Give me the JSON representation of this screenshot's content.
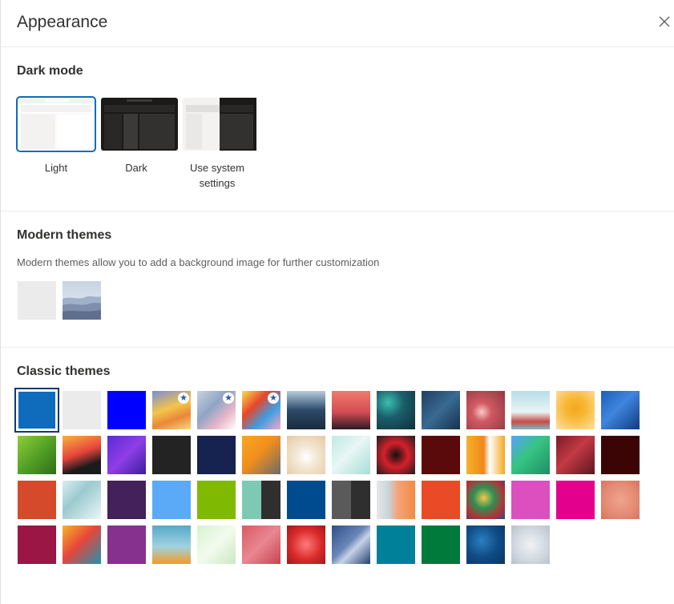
{
  "header": {
    "title": "Appearance",
    "close_icon": "close-icon"
  },
  "dark_mode": {
    "title": "Dark mode",
    "options": [
      {
        "label_lines": [
          "Light"
        ],
        "selected": true
      },
      {
        "label_lines": [
          "Dark"
        ],
        "selected": false
      },
      {
        "label_lines": [
          "Use system",
          "settings"
        ],
        "selected": false
      }
    ]
  },
  "modern_themes": {
    "title": "Modern themes",
    "description": "Modern themes allow you to add a background image for further customization",
    "items": [
      "blank-theme",
      "landscape-theme"
    ]
  },
  "classic_themes": {
    "title": "Classic themes",
    "selected_index": 0,
    "starred_indices": [
      3,
      4,
      5
    ],
    "tiles": [
      "#0f6cbd",
      "#ebebeb",
      "#0000ff",
      "linear-gradient(160deg,#7a8ed6 0%,#f3c548 45%,#e9873a 70%,#f6d77a 100%)",
      "linear-gradient(135deg,#c9d2e0 0%,#8fa4c6 40%,#e7b6c8 70%,#ffffff 100%)",
      "linear-gradient(135deg,#f7e04a 0%,#e8452c 35%,#3f9de0 65%,#f4a7c5 100%)",
      "linear-gradient(180deg,#b7cde0 0%,#2c4a6a 50%,#1a2b3e 100%)",
      "linear-gradient(180deg,#f27a6d 0%,#d44b52 55%,#2a1b24 100%)",
      "radial-gradient(circle at 30% 30%,#3bbfad 0%,#1b5f6b 40%,#0e2f38 100%)",
      "linear-gradient(135deg,#1f3f63 0%,#3a6a92 50%,#15314f 100%)",
      "radial-gradient(circle at 40% 55%,#f6c9c9 0%,#d25a62 30%,#8f3740 100%)",
      "linear-gradient(180deg,#b8dde8 0%,#e8f4f6 55%,#c74b46 80%,#7fb7c7 100%)",
      "radial-gradient(circle at 50% 45%,#f5a623 0%,#f7b733 35%,#ffe0a0 100%)",
      "linear-gradient(135deg,#1e5fb8 0%,#3f85de 45%,#0f3a7e 100%)",
      "linear-gradient(135deg,#8fce3a 0%,#4f9c23 55%,#2f6d1a 100%)",
      "linear-gradient(160deg,#f4b63f 0%,#e8453c 45%,#1b1b1b 75%)",
      "linear-gradient(135deg,#5b2bd6 0%,#8e3ee6 50%,#3d1c9e 100%)",
      "#232323",
      "#16224f",
      "linear-gradient(135deg,#f7a823 0%,#f28e1c 45%,#6b6b6b 100%)",
      "radial-gradient(circle at 50% 55%,#ffffff 0%,#f1e7d2 40%,#e9c7a3 100%)",
      "linear-gradient(135deg,#bfe8e3 0%,#e9f7f5 45%,#a6ddd6 100%)",
      "radial-gradient(circle at 50% 50%,#111111 0%,#d6202b 45%,#1d1d1d 100%)",
      "#5a0a0a",
      "linear-gradient(90deg,#f5b229 0%,#f0861a 45%,#ffffff 60%,#f4a820 100%)",
      "linear-gradient(135deg,#5aa0ff 0%,#36c483 45%,#1f8d63 100%)",
      "linear-gradient(135deg,#7a1c26 0%,#c23a44 45%,#5e1520 100%)",
      "#3b0505",
      "#d44a2a",
      "linear-gradient(135deg,#d8eef2 0%,#9cc9cf 40%,#e8f6f7 100%)",
      "#44215a",
      "#5aaaf7",
      "#7fba00",
      "linear-gradient(90deg,#7ec9b4 0%,#7ec9b4 50%,#2f2f2f 50%,#2f2f2f 100%)",
      "#004b8f",
      "linear-gradient(90deg,#5a5a5a 0%,#5a5a5a 50%,#2f2f2f 50%,#2f2f2f 100%)",
      "linear-gradient(90deg,#e7e7e7 0%,#c9d4dc 30%,#f4a37a 55%,#f28b3f 100%)",
      "#e84b25",
      "radial-gradient(circle at 45% 45%,#f2c94c 0%,#2f8f55 35%,#b53035 70%,#1b4f8a 100%)",
      "#dc4fbf",
      "#e3008c",
      "radial-gradient(circle at 50% 50%,#f0a48d 0%,#e48a73 60%,#d8735c 100%)",
      "#9b1545",
      "linear-gradient(135deg,#f5b629 0%,#e8453c 45%,#1f93b0 100%)",
      "#87318f",
      "linear-gradient(180deg,#58a7c9 0%,#9fd3e0 55%,#f59a23 100%)",
      "linear-gradient(135deg,#d8f3ce 0%,#f2fbee 50%,#cbe8c0 100%)",
      "linear-gradient(135deg,#d85a63 0%,#e98790 50%,#c74450 100%)",
      "radial-gradient(circle at 50% 50%,#ff7b7b 0%,#d92b2b 55%,#a51616 100%)",
      "linear-gradient(135deg,#2f4f86 0%,#6a86b8 45%,#c7d3e8 60%,#24406f 100%)",
      "#008099",
      "#007a3b",
      "radial-gradient(circle at 40% 40%,#2a7fbf 0%,#0f4c86 50%,#0a355e 100%)",
      "radial-gradient(circle at 50% 50%,#f0f3f6 0%,#cfd7df 60%,#b7c2cc 100%)"
    ]
  }
}
